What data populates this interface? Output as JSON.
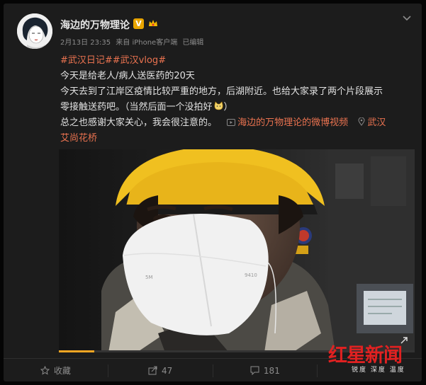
{
  "post": {
    "username": "海边的万物理论",
    "verified_badge": "V",
    "meta": {
      "date": "2月13日 23:35",
      "source": "来自 iPhone客户端",
      "edited": "已编辑"
    },
    "hashtags": "#武汉日记##武汉vlog#",
    "lines": [
      "今天是给老人/病人送医药的20天",
      "今天去到了江岸区疫情比较严重的地方，后湖附近。也给大家录了两个片段展示",
      "零接触送药吧。（当然后面一个没拍好"
    ],
    "line4_prefix": "总之也感谢大家关心，我会很注意的。",
    "video_link": "海边的万物理论的微博视频",
    "location_city": "武汉",
    "location_place": "艾尚花桥"
  },
  "video": {
    "progress_fraction": 0.1
  },
  "actions": {
    "favorite": "收藏",
    "repost": "47",
    "comment": "181",
    "like": ""
  },
  "watermark": {
    "brand": "红星新闻",
    "slogan": "锐度 深度 温度"
  },
  "colors": {
    "card_bg": "#1c1c1c",
    "link": "#eb7350",
    "badge": "#e8a500",
    "progress": "#f5a623",
    "brand_red": "#e02121"
  }
}
